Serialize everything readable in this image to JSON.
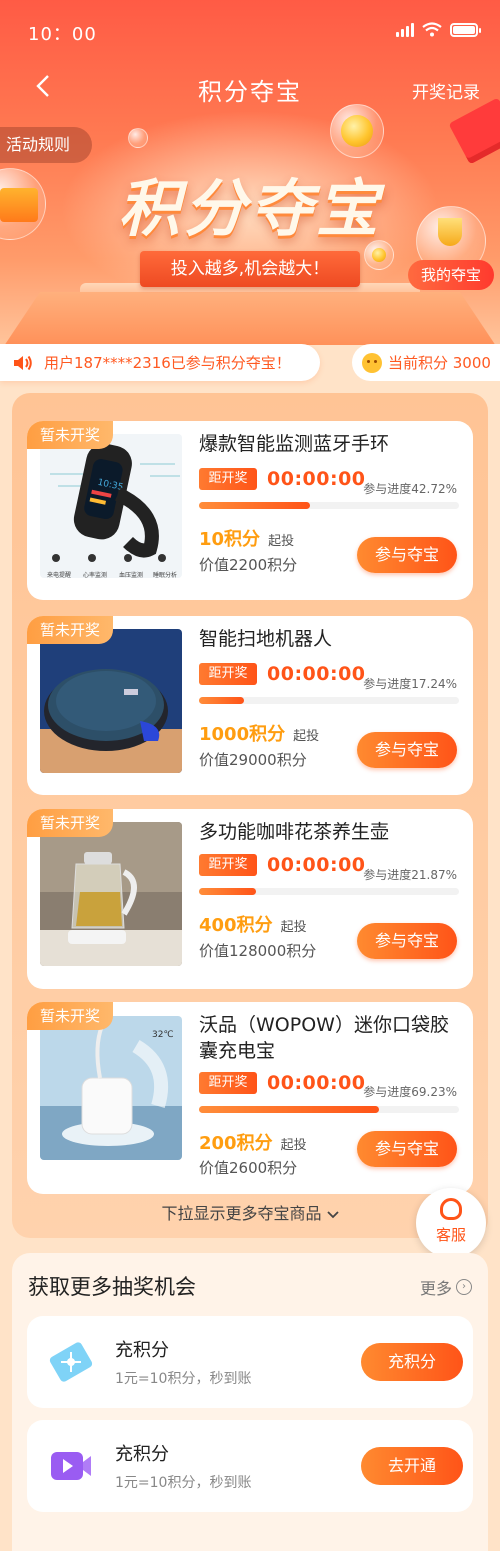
{
  "status_bar": {
    "time": "10：00"
  },
  "nav": {
    "back_icon": "chevron-left-icon",
    "title": "积分夺宝",
    "right_link": "开奖记录"
  },
  "hero": {
    "rules_tab": "活动规则",
    "big_title": "积分夺宝",
    "slogan": "投入越多,机会越大！",
    "my_treasure": "我的夺宝"
  },
  "notice": {
    "text": "用户187****2316已参与积分夺宝！",
    "points_label": "当前积分 3000"
  },
  "products": [
    {
      "tag": "暂未开奖",
      "title": "爆款智能监测蓝牙手环",
      "timer_label": "距开奖",
      "timer": "00:00:00",
      "progress_text": "参与进度42.72%",
      "progress": 0.4272,
      "price": "10积分",
      "price_suffix": "起投",
      "worth": "价值2200积分",
      "button": "参与夺宝",
      "image": "smart-band",
      "image_captions": [
        "来电提醒",
        "心率监测",
        "血压监测",
        "睡眠分析"
      ]
    },
    {
      "tag": "暂未开奖",
      "title": "智能扫地机器人",
      "timer_label": "距开奖",
      "timer": "00:00:00",
      "progress_text": "参与进度17.24%",
      "progress": 0.1724,
      "price": "1000积分",
      "price_suffix": "起投",
      "worth": "价值29000积分",
      "button": "参与夺宝",
      "image": "robot-vacuum"
    },
    {
      "tag": "暂未开奖",
      "title": "多功能咖啡花茶养生壶",
      "timer_label": "距开奖",
      "timer": "00:00:00",
      "progress_text": "参与进度21.87%",
      "progress": 0.2187,
      "price": "400积分",
      "price_suffix": "起投",
      "worth": "价值128000积分",
      "button": "参与夺宝",
      "image": "tea-kettle"
    },
    {
      "tag": "暂未开奖",
      "title": "沃品（WOPOW）迷你口袋胶囊充电宝",
      "timer_label": "距开奖",
      "timer": "00:00:00",
      "progress_text": "参与进度69.23%",
      "progress": 0.6923,
      "price": "200积分",
      "price_suffix": "起投",
      "worth": "价值2600积分",
      "button": "参与夺宝",
      "image": "power-bank",
      "image_caption": "32℃"
    }
  ],
  "more_hint": "下拉显示更多夺宝商品",
  "customer_service": "客服",
  "more_chances": {
    "title": "获取更多抽奖机会",
    "more": "更多",
    "tasks": [
      {
        "icon": "ticket-icon",
        "name": "充积分",
        "desc": "1元=10积分，秒到账",
        "button": "充积分"
      },
      {
        "icon": "video-icon",
        "name": "充积分",
        "desc": "1元=10积分，秒到账",
        "button": "去开通"
      }
    ]
  },
  "colors": {
    "accent": "#ff5418",
    "price": "#ff9d10",
    "tag": "#ff9e42",
    "background": "#ffe3c8"
  }
}
